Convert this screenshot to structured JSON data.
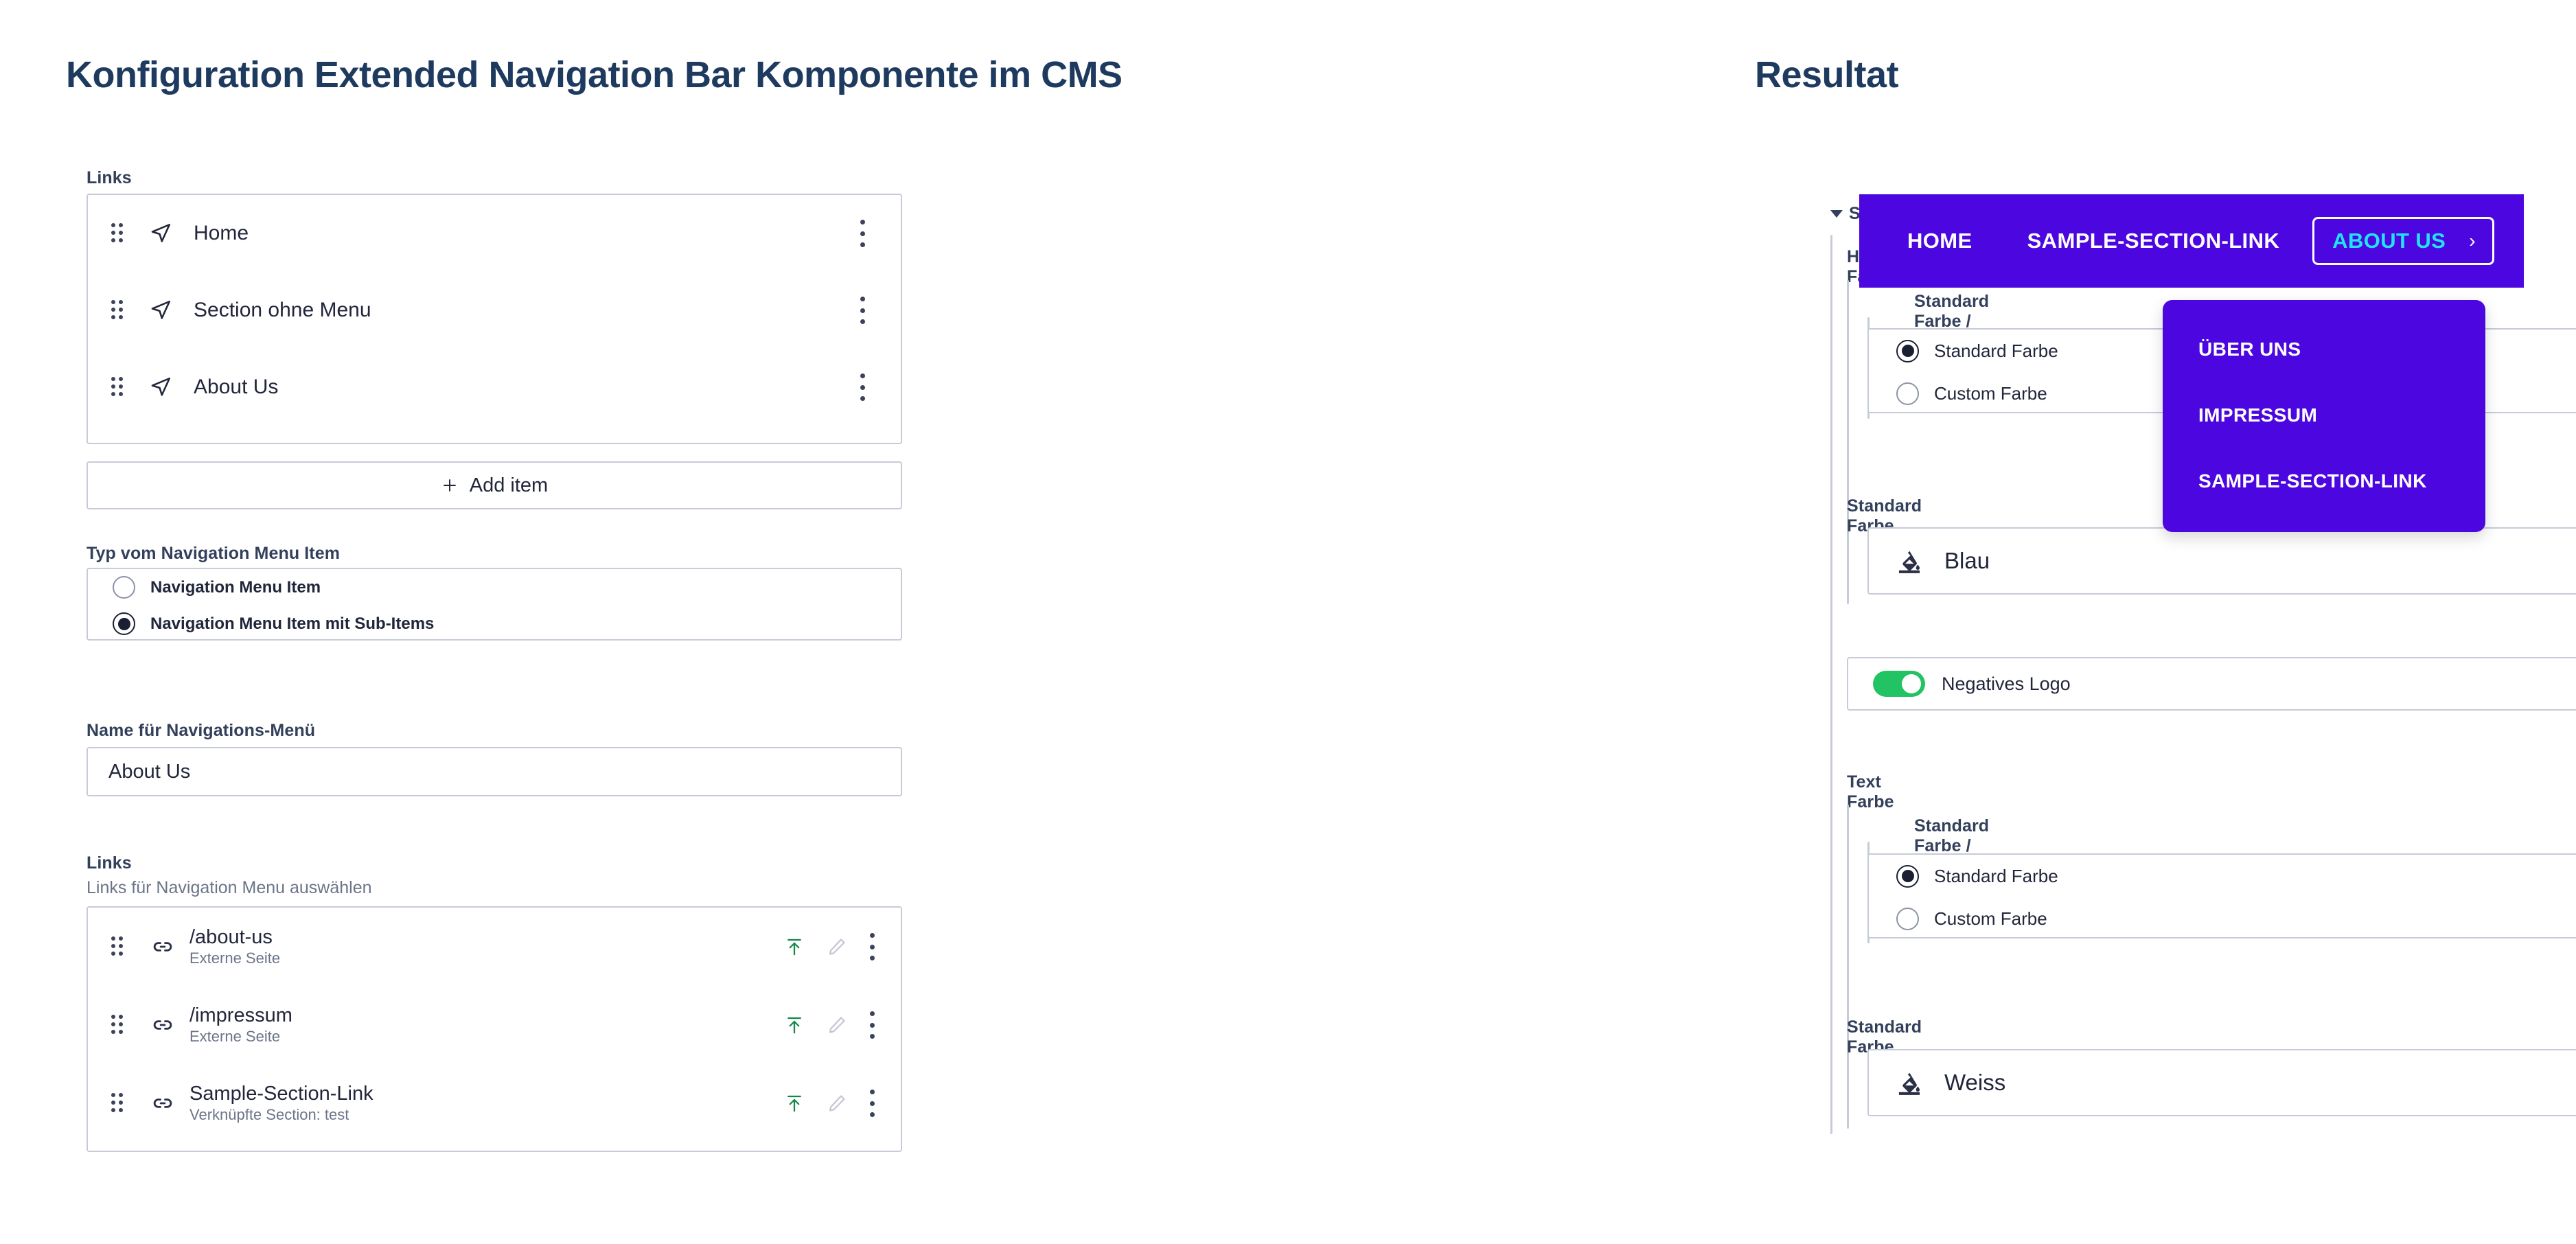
{
  "headings": {
    "config": "Konfiguration Extended Navigation Bar Komponente im CMS",
    "result": "Resultat"
  },
  "left_panel": {
    "links_label": "Links",
    "nav_items": [
      {
        "label": "Home"
      },
      {
        "label": "Section ohne Menu"
      },
      {
        "label": "About Us"
      }
    ],
    "add_item_label": "Add item",
    "type_label": "Typ vom Navigation Menu Item",
    "type_options": [
      {
        "label": "Navigation Menu Item",
        "selected": false
      },
      {
        "label": "Navigation Menu Item mit Sub-Items",
        "selected": true
      }
    ],
    "name_label": "Name für Navigations-Menü",
    "name_value": "About Us",
    "links_section_label": "Links",
    "links_section_sub": "Links für Navigation Menu auswählen",
    "links": [
      {
        "title": "/about-us",
        "subtitle": "Externe Seite"
      },
      {
        "title": "/impressum",
        "subtitle": "Externe Seite"
      },
      {
        "title": "Sample-Section-Link",
        "subtitle": "Verknüpfte Section: test"
      }
    ]
  },
  "styling_panel": {
    "section_title": "Styling",
    "background": {
      "group_label": "Hintergrund Farbe",
      "mode_label": "Standard Farbe / Custom Farbe",
      "mode_options": [
        {
          "label": "Standard Farbe",
          "selected": true
        },
        {
          "label": "Custom Farbe",
          "selected": false
        }
      ],
      "color_label": "Standard Farbe",
      "color_value": "Blau"
    },
    "negatives_logo": {
      "label": "Negatives Logo",
      "enabled": true
    },
    "text": {
      "group_label": "Text Farbe",
      "mode_label": "Standard Farbe / Custom Farbe",
      "mode_options": [
        {
          "label": "Standard Farbe",
          "selected": true
        },
        {
          "label": "Custom Farbe",
          "selected": false
        }
      ],
      "color_label": "Standard Farbe",
      "color_value": "Weiss"
    }
  },
  "result": {
    "navbar": {
      "background_color": "#4C07E0",
      "text_color": "#FFFFFF",
      "active_text_color": "#21E4FB",
      "links": [
        "HOME",
        "SAMPLE-SECTION-LINK"
      ],
      "active_link": "ABOUT US",
      "active_chevron": "›"
    },
    "dropdown": {
      "items": [
        "ÜBER UNS",
        "IMPRESSUM",
        "SAMPLE-SECTION-LINK"
      ]
    }
  }
}
